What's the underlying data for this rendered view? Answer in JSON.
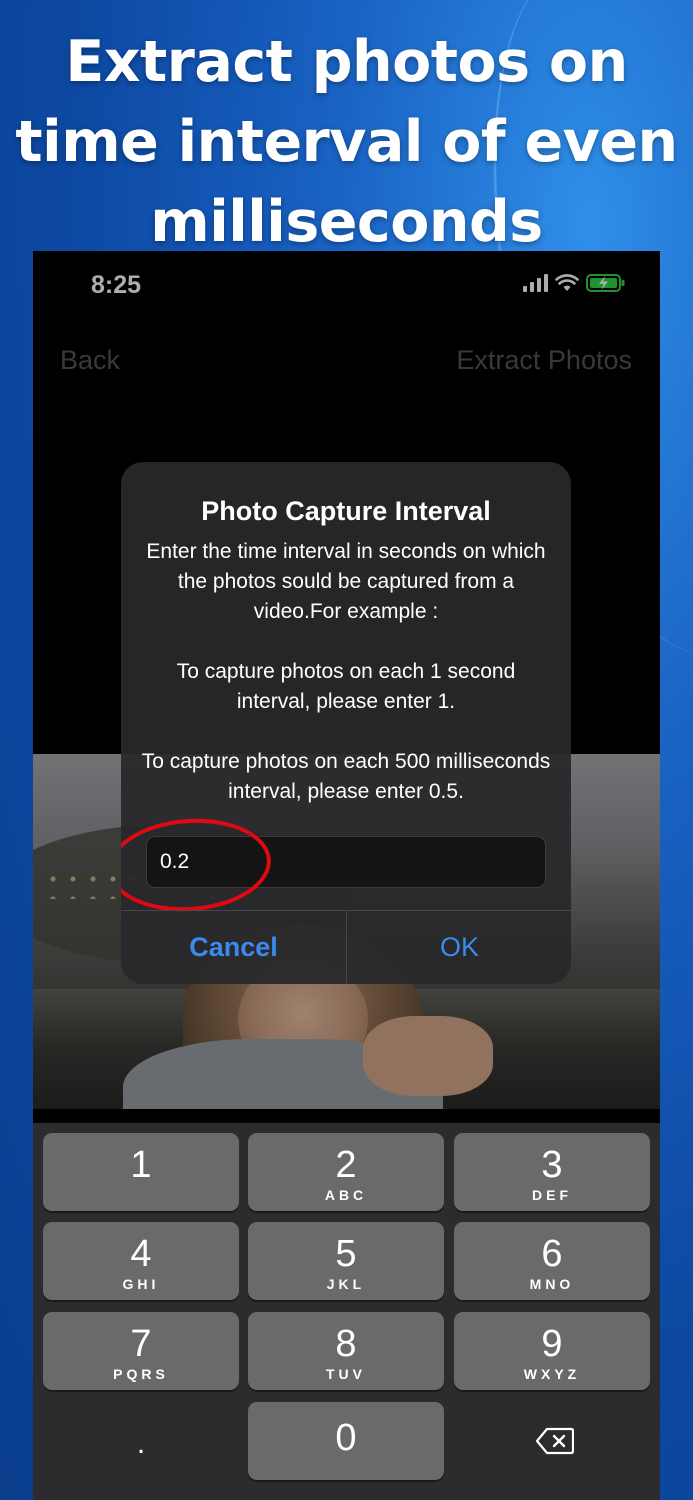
{
  "headline": "Extract photos on time interval of even milliseconds",
  "status_bar": {
    "time": "8:25",
    "icons": [
      "cellular-signal-icon",
      "wifi-icon",
      "battery-charging-icon"
    ]
  },
  "nav": {
    "back_label": "Back",
    "right_label": "Extract Photos"
  },
  "alert": {
    "title": "Photo Capture Interval",
    "message_1": "Enter the time interval in seconds on which the photos sould be captured from a video.For example :",
    "message_2": "To capture photos on each 1 second interval, please enter 1.",
    "message_3": "To capture photos on each 500 milliseconds interval, please enter 0.5.",
    "input_value": "0.2",
    "cancel_label": "Cancel",
    "ok_label": "OK"
  },
  "keypad": {
    "keys": [
      {
        "digit": "1",
        "letters": ""
      },
      {
        "digit": "2",
        "letters": "ABC"
      },
      {
        "digit": "3",
        "letters": "DEF"
      },
      {
        "digit": "4",
        "letters": "GHI"
      },
      {
        "digit": "5",
        "letters": "JKL"
      },
      {
        "digit": "6",
        "letters": "MNO"
      },
      {
        "digit": "7",
        "letters": "PQRS"
      },
      {
        "digit": "8",
        "letters": "TUV"
      },
      {
        "digit": "9",
        "letters": "WXYZ"
      },
      {
        "digit": ".",
        "letters": ""
      },
      {
        "digit": "0",
        "letters": ""
      }
    ]
  },
  "colors": {
    "accent": "#3b8aed",
    "annotation": "#e00912",
    "background": "#0d4aa4"
  }
}
